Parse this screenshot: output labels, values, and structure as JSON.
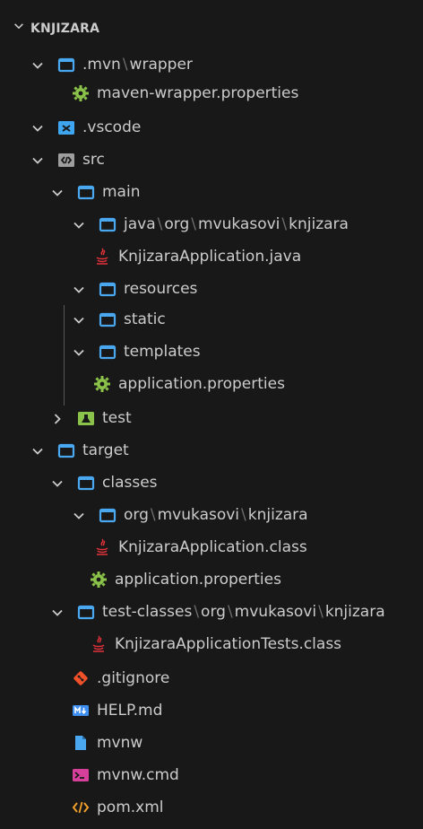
{
  "explorer": {
    "section_title": "KNJIZARA"
  },
  "tree": [
    {
      "id": "mvn-wrapper",
      "parts": [
        ".mvn",
        "wrapper"
      ],
      "type": "folder",
      "expanded": true
    },
    {
      "id": "maven-wrapper-properties",
      "parts": [
        "maven-wrapper.properties"
      ],
      "type": "gear-file"
    },
    {
      "id": "vscode",
      "parts": [
        ".vscode"
      ],
      "type": "vscode-folder",
      "expanded": true
    },
    {
      "id": "src",
      "parts": [
        "src"
      ],
      "type": "src-folder",
      "expanded": true
    },
    {
      "id": "main",
      "parts": [
        "main"
      ],
      "type": "folder",
      "expanded": true
    },
    {
      "id": "java-org-mvukasovi-knjizara",
      "parts": [
        "java",
        "org",
        "mvukasovi",
        "knjizara"
      ],
      "type": "folder",
      "expanded": true
    },
    {
      "id": "knjizara-application-java",
      "parts": [
        "KnjizaraApplication.java"
      ],
      "type": "java-file"
    },
    {
      "id": "resources",
      "parts": [
        "resources"
      ],
      "type": "folder",
      "expanded": true
    },
    {
      "id": "static",
      "parts": [
        "static"
      ],
      "type": "folder",
      "expanded": true
    },
    {
      "id": "templates",
      "parts": [
        "templates"
      ],
      "type": "folder",
      "expanded": true
    },
    {
      "id": "application-properties-src",
      "parts": [
        "application.properties"
      ],
      "type": "gear-file"
    },
    {
      "id": "test",
      "parts": [
        "test"
      ],
      "type": "test-folder",
      "expanded": false
    },
    {
      "id": "target",
      "parts": [
        "target"
      ],
      "type": "folder",
      "expanded": true
    },
    {
      "id": "classes",
      "parts": [
        "classes"
      ],
      "type": "folder",
      "expanded": true
    },
    {
      "id": "org-mvukasovi-knjizara",
      "parts": [
        "org",
        "mvukasovi",
        "knjizara"
      ],
      "type": "folder",
      "expanded": true
    },
    {
      "id": "knjizara-application-class",
      "parts": [
        "KnjizaraApplication.class"
      ],
      "type": "java-file"
    },
    {
      "id": "application-properties-target",
      "parts": [
        "application.properties"
      ],
      "type": "gear-file"
    },
    {
      "id": "test-classes",
      "parts": [
        "test-classes",
        "org",
        "mvukasovi",
        "knjizara"
      ],
      "type": "folder",
      "expanded": true
    },
    {
      "id": "knjizara-application-tests-class",
      "parts": [
        "KnjizaraApplicationTests.class"
      ],
      "type": "java-file"
    },
    {
      "id": "gitignore",
      "parts": [
        ".gitignore"
      ],
      "type": "git-file"
    },
    {
      "id": "help-md",
      "parts": [
        "HELP.md"
      ],
      "type": "markdown-file"
    },
    {
      "id": "mvnw",
      "parts": [
        "mvnw"
      ],
      "type": "plain-file"
    },
    {
      "id": "mvnw-cmd",
      "parts": [
        "mvnw.cmd"
      ],
      "type": "terminal-file"
    },
    {
      "id": "pom-xml",
      "parts": [
        "pom.xml"
      ],
      "type": "xml-file"
    }
  ],
  "path_separator": "\\",
  "colors": {
    "background": "#181818",
    "text": "#cccccc",
    "separator": "#6e6e6e",
    "folder_icon": "#4aa8f0",
    "gear_icon": "#8bc34a",
    "java_icon": "#e2323a",
    "git_icon": "#f0502a",
    "markdown_icon": "#3f8ff0",
    "terminal_icon": "#d63f9a",
    "xml_icon": "#f0a02a",
    "test_icon": "#8bc34a",
    "vscode_icon": "#3ea6f0",
    "file_icon": "#4aa8f0"
  }
}
